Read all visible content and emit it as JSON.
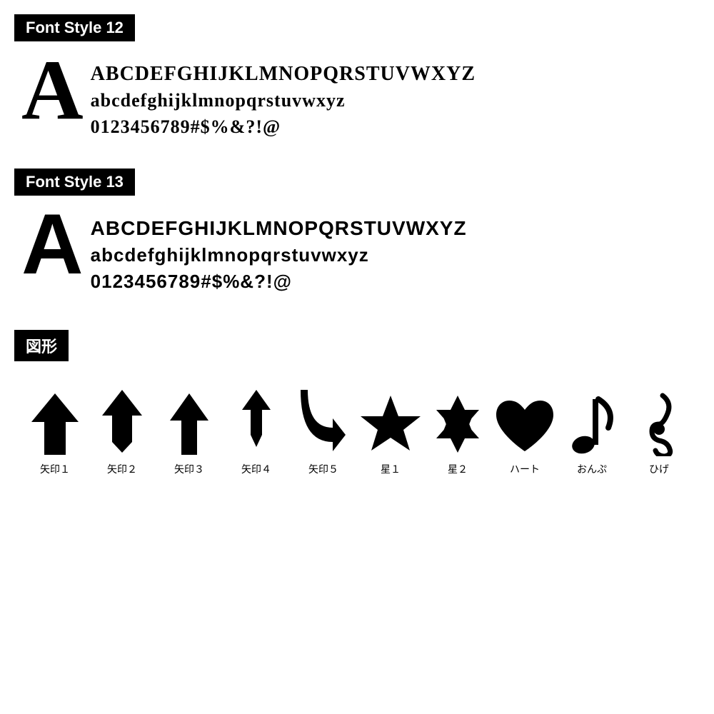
{
  "sections": {
    "font12": {
      "header": "Font Style 12",
      "bigA": "A",
      "uppercase": "BCDEFGHIJKLMNOPQRSTUVWXYZ",
      "lowercase": "abcdefghijklmnopqrstuvwxyz",
      "numbers": "0123456789#$%&?!@"
    },
    "font13": {
      "header": "Font Style 13",
      "bigA": "A",
      "uppercase": "BCDEFGHIJKLMNOPQRSTUVWXYZ",
      "lowercase": "abcdefghijklmnopqrstuvwxyz",
      "numbers": "0123456789#$%&?!@"
    },
    "figures": {
      "header": "図形",
      "items": [
        {
          "label": "矢印１",
          "name": "arrow1"
        },
        {
          "label": "矢印２",
          "name": "arrow2"
        },
        {
          "label": "矢印３",
          "name": "arrow3"
        },
        {
          "label": "矢印４",
          "name": "arrow4"
        },
        {
          "label": "矢印５",
          "name": "arrow5"
        },
        {
          "label": "星１",
          "name": "star1"
        },
        {
          "label": "星２",
          "name": "star2"
        },
        {
          "label": "ハート",
          "name": "heart"
        },
        {
          "label": "おんぷ",
          "name": "note"
        },
        {
          "label": "ひげ",
          "name": "mustache"
        }
      ]
    }
  }
}
